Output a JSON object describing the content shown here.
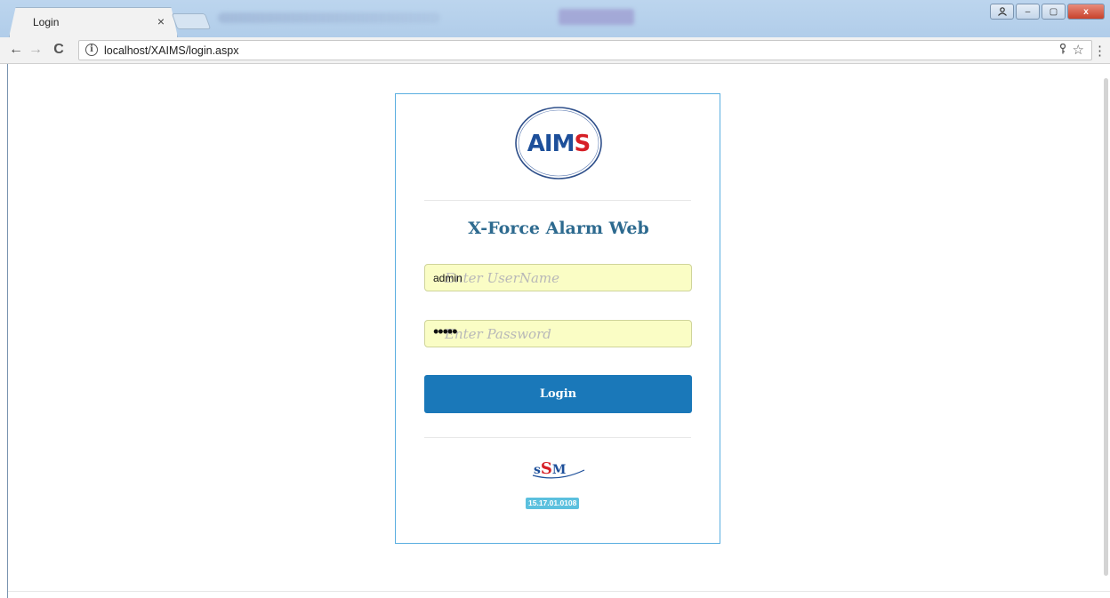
{
  "browser": {
    "tab_title": "Login",
    "tab_close": "×",
    "url": "localhost/XAIMS/login.aspx",
    "nav": {
      "back": "←",
      "forward": "→",
      "reload": "C"
    },
    "window_controls": {
      "user": "⛭",
      "minimize": "–",
      "maximize": "▢",
      "close": "x"
    },
    "menu": "⋮",
    "icons": {
      "info": "i",
      "key": "⚲",
      "star": "☆"
    }
  },
  "login": {
    "logo_text": "AIMS",
    "title": "X-Force Alarm Web",
    "username": {
      "value": "admin",
      "placeholder": "Enter UserName"
    },
    "password": {
      "value": "•••••",
      "placeholder": "Enter Password"
    },
    "button_label": "Login",
    "footer_logo_text": "SSM",
    "version": "15.17.01.0108"
  },
  "colors": {
    "accent": "#1a78b9",
    "title": "#2d6a8f",
    "card_border": "#5aaee0",
    "input_autofill": "#fafdc5",
    "badge": "#5bc0de"
  }
}
